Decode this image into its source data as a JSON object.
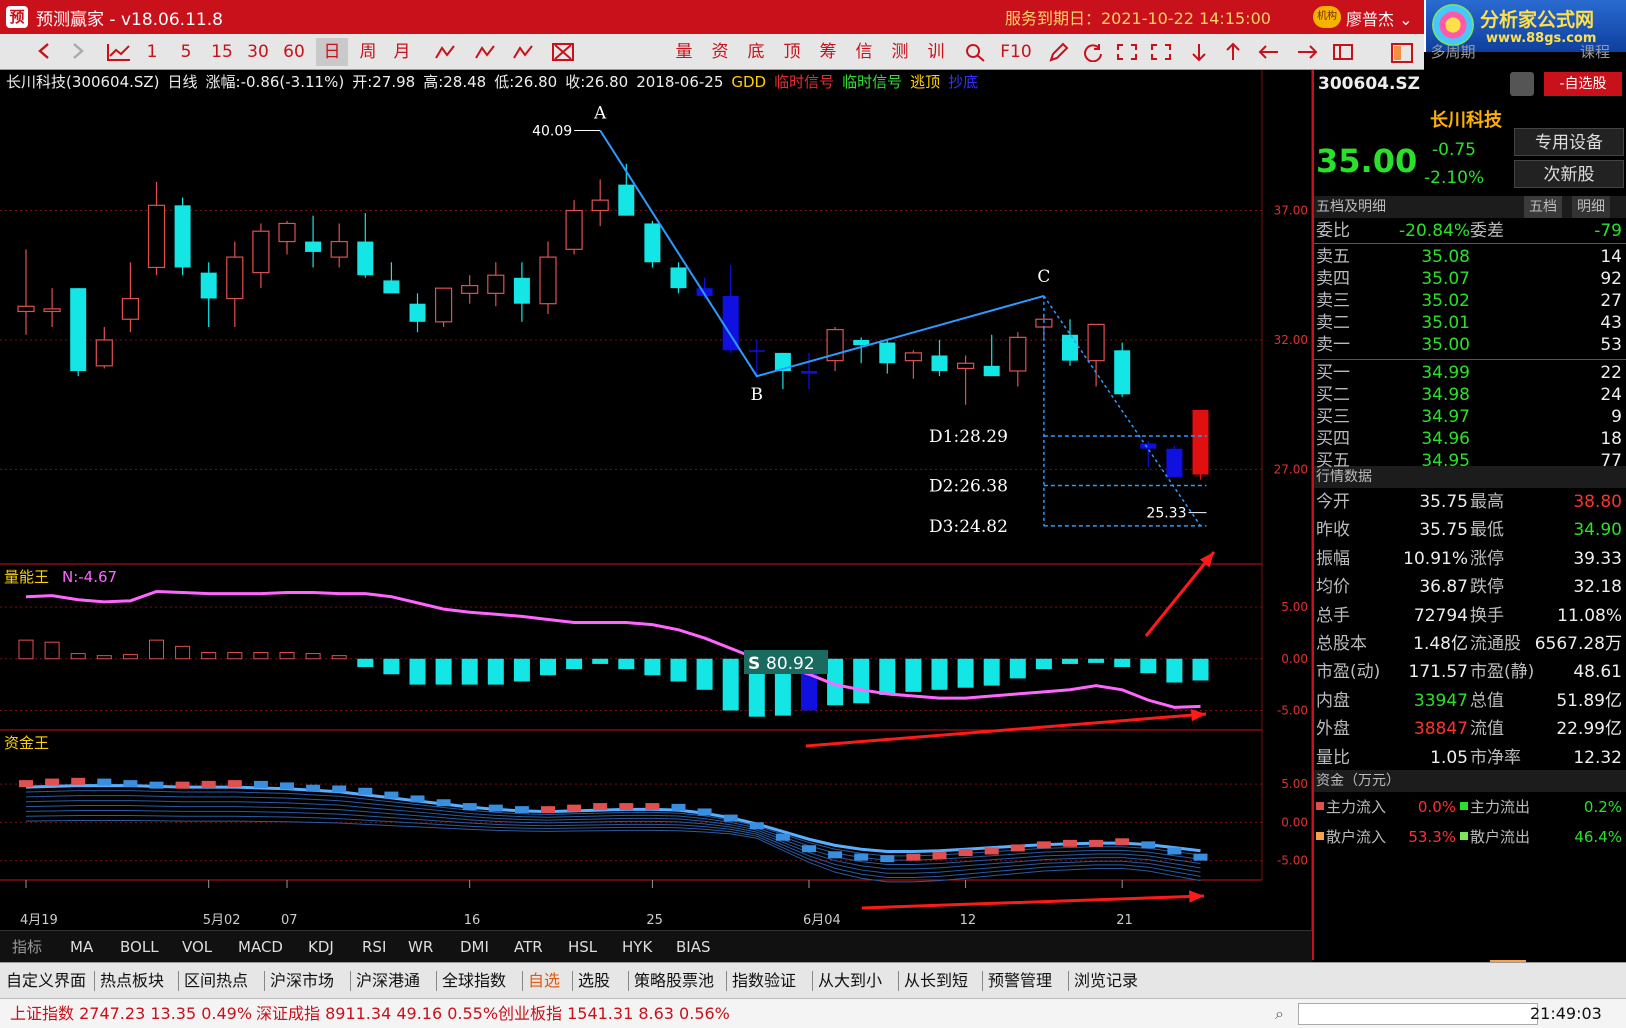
{
  "app": {
    "logo_char": "预",
    "title": "预测赢家 - v18.06.11.8",
    "service": "服务到期日：2021-10-22 14:15:00",
    "badge": "机构",
    "user": "廖普杰",
    "brand_name": "分析家公式网",
    "brand_url": "www.88gs.com"
  },
  "toolbar": {
    "items": [
      "1",
      "5",
      "15",
      "30",
      "60",
      "日",
      "周",
      "月",
      "量",
      "资",
      "底",
      "顶",
      "筹",
      "信",
      "测",
      "训",
      "F10"
    ],
    "active": "日",
    "right_gray": "多周期",
    "right_gray2": "课程"
  },
  "info": {
    "stock": "长川科技(300604.SZ)",
    "period": "日线",
    "change": "涨幅:-0.86(-3.11%)",
    "open": "开:27.98",
    "high": "高:28.48",
    "low": "低:26.80",
    "close": "收:26.80",
    "date": "2018-06-25",
    "s1": "GDD",
    "s2": "临时信号",
    "s3": "临时信号",
    "s4": "逃顶",
    "s5": "抄底"
  },
  "colors": {
    "up": "#e05050",
    "down": "#14e6e6",
    "blue": "#1010e0",
    "red": "#e01010",
    "wave": "#2b9bff",
    "magenta": "#ff66ff",
    "grid": "#7a1010"
  },
  "annotations": {
    "A": "A",
    "B": "B",
    "C": "C",
    "top_value": "40.09",
    "d1": "D1:28.29",
    "d2": "D2:26.38",
    "d3": "D3:24.82",
    "low_value": "25.33"
  },
  "chart_data": [
    {
      "type": "candlestick",
      "title": "",
      "ylim": [
        23.5,
        41.5
      ],
      "yticks": [
        27.0,
        32.0,
        37.0
      ],
      "ytick_labels": [
        "27.00",
        "32.00",
        "37.00"
      ],
      "candles": [
        {
          "o": 33.1,
          "h": 35.5,
          "l": 32.2,
          "c": 33.3
        },
        {
          "o": 33.1,
          "h": 34.0,
          "l": 32.5,
          "c": 33.2
        },
        {
          "o": 34.0,
          "h": 34.0,
          "l": 30.6,
          "c": 30.8
        },
        {
          "o": 31.0,
          "h": 32.5,
          "l": 30.9,
          "c": 32.0
        },
        {
          "o": 32.8,
          "h": 35.0,
          "l": 32.3,
          "c": 33.6
        },
        {
          "o": 34.8,
          "h": 38.1,
          "l": 34.5,
          "c": 37.2
        },
        {
          "o": 37.2,
          "h": 37.5,
          "l": 34.5,
          "c": 34.8
        },
        {
          "o": 34.6,
          "h": 35.0,
          "l": 32.5,
          "c": 33.6
        },
        {
          "o": 33.6,
          "h": 35.8,
          "l": 32.5,
          "c": 35.2
        },
        {
          "o": 34.6,
          "h": 36.5,
          "l": 34.0,
          "c": 36.2
        },
        {
          "o": 35.8,
          "h": 36.6,
          "l": 35.3,
          "c": 36.5
        },
        {
          "o": 35.8,
          "h": 36.8,
          "l": 34.8,
          "c": 35.4
        },
        {
          "o": 35.2,
          "h": 36.5,
          "l": 34.8,
          "c": 35.8
        },
        {
          "o": 35.8,
          "h": 36.9,
          "l": 34.4,
          "c": 34.5
        },
        {
          "o": 34.3,
          "h": 35.0,
          "l": 33.9,
          "c": 33.8
        },
        {
          "o": 33.4,
          "h": 33.8,
          "l": 32.3,
          "c": 32.7
        },
        {
          "o": 32.7,
          "h": 34.0,
          "l": 32.5,
          "c": 34.0
        },
        {
          "o": 33.8,
          "h": 34.5,
          "l": 33.4,
          "c": 34.1
        },
        {
          "o": 33.8,
          "h": 35.0,
          "l": 33.3,
          "c": 34.5
        },
        {
          "o": 34.4,
          "h": 35.0,
          "l": 32.7,
          "c": 33.4
        },
        {
          "o": 33.4,
          "h": 35.8,
          "l": 33.0,
          "c": 35.2
        },
        {
          "o": 35.5,
          "h": 37.4,
          "l": 35.3,
          "c": 37.0
        },
        {
          "o": 37.0,
          "h": 38.2,
          "l": 36.4,
          "c": 37.4
        },
        {
          "o": 38.0,
          "h": 38.8,
          "l": 36.8,
          "c": 36.8
        },
        {
          "o": 36.5,
          "h": 36.6,
          "l": 34.8,
          "c": 35.0
        },
        {
          "o": 34.8,
          "h": 35.0,
          "l": 33.8,
          "c": 34.0
        },
        {
          "o": 34.0,
          "h": 34.4,
          "l": 33.6,
          "c": 33.7
        },
        {
          "o": 33.7,
          "h": 34.9,
          "l": 31.5,
          "c": 31.6
        },
        {
          "o": 31.6,
          "h": 32.0,
          "l": 30.6,
          "c": 31.6
        },
        {
          "o": 31.5,
          "h": 31.5,
          "l": 30.1,
          "c": 30.8
        },
        {
          "o": 30.8,
          "h": 31.5,
          "l": 30.1,
          "c": 30.7
        },
        {
          "o": 31.2,
          "h": 32.5,
          "l": 30.8,
          "c": 32.4
        },
        {
          "o": 32.0,
          "h": 32.1,
          "l": 31.1,
          "c": 31.8
        },
        {
          "o": 31.9,
          "h": 32.0,
          "l": 30.7,
          "c": 31.1
        },
        {
          "o": 31.2,
          "h": 31.6,
          "l": 30.5,
          "c": 31.5
        },
        {
          "o": 31.4,
          "h": 32.0,
          "l": 30.6,
          "c": 30.8
        },
        {
          "o": 30.9,
          "h": 31.4,
          "l": 29.5,
          "c": 31.1
        },
        {
          "o": 31.0,
          "h": 32.2,
          "l": 30.6,
          "c": 30.6
        },
        {
          "o": 30.8,
          "h": 32.3,
          "l": 30.2,
          "c": 32.1
        },
        {
          "o": 32.5,
          "h": 33.0,
          "l": 32.0,
          "c": 32.8
        },
        {
          "o": 32.2,
          "h": 32.8,
          "l": 31.0,
          "c": 31.2
        },
        {
          "o": 31.2,
          "h": 32.6,
          "l": 30.2,
          "c": 32.6
        },
        {
          "o": 31.6,
          "h": 31.9,
          "l": 29.8,
          "c": 29.9
        },
        {
          "o": 28.0,
          "h": 28.1,
          "l": 27.1,
          "c": 27.8
        },
        {
          "o": 27.8,
          "h": 27.9,
          "l": 26.7,
          "c": 26.7
        },
        {
          "o": 26.8,
          "h": 29.3,
          "l": 26.6,
          "c": 29.3
        }
      ],
      "special": {
        "43": "blue",
        "44": "blue",
        "45": "red",
        "26": "blue",
        "27": "blue",
        "28": "blue",
        "30": "blue"
      }
    },
    {
      "type": "bar",
      "title": "量能王",
      "series_label": "N:-4.67",
      "yticks": [
        5.0,
        0.0,
        -5.0
      ],
      "ytick_labels": [
        "5.00",
        "0.00",
        "-5.00"
      ],
      "ylim": [
        -6.5,
        8.0
      ],
      "label_value": "80.92",
      "values": [
        1.8,
        1.6,
        0.5,
        0.3,
        0.4,
        1.8,
        1.2,
        0.6,
        0.6,
        0.6,
        0.6,
        0.5,
        0.3,
        -0.8,
        -1.5,
        -2.5,
        -2.5,
        -2.5,
        -2.5,
        -2.2,
        -1.6,
        -1.0,
        -0.5,
        -1.0,
        -1.6,
        -2.2,
        -3.0,
        -5.0,
        -5.6,
        -5.5,
        -5.0,
        -4.5,
        -4.3,
        -3.5,
        -3.2,
        -3.0,
        -2.8,
        -2.6,
        -1.9,
        -1.0,
        -0.5,
        -0.4,
        -0.8,
        -1.4,
        -2.3,
        -2.1
      ],
      "line": [
        6.0,
        6.1,
        5.7,
        5.5,
        5.6,
        6.5,
        6.4,
        6.3,
        6.3,
        6.3,
        6.4,
        6.4,
        6.3,
        6.3,
        6.0,
        5.4,
        4.8,
        4.5,
        4.3,
        4.1,
        3.8,
        3.5,
        3.5,
        3.5,
        3.3,
        2.8,
        2.0,
        1.0,
        0.0,
        -0.7,
        -1.5,
        -2.5,
        -3.0,
        -3.4,
        -3.6,
        -3.8,
        -3.8,
        -3.6,
        -3.4,
        -3.2,
        -3.0,
        -2.6,
        -3.0,
        -4.0,
        -4.7,
        -4.6
      ]
    },
    {
      "type": "bar",
      "title": "资金王",
      "yticks": [
        5.0,
        0.0,
        -5.0
      ],
      "ytick_labels": [
        "5.00",
        "0.00",
        "-5.00"
      ],
      "ylim": [
        -7.0,
        10.5
      ],
      "values": [
        5.0,
        5.2,
        5.3,
        5.2,
        5.0,
        4.8,
        4.8,
        4.9,
        5.0,
        4.9,
        4.7,
        4.4,
        4.3,
        4.0,
        3.5,
        3.0,
        2.5,
        2.0,
        1.8,
        1.6,
        1.6,
        1.8,
        2.0,
        2.0,
        2.0,
        1.9,
        1.3,
        0.5,
        -0.5,
        -2.0,
        -3.5,
        -4.3,
        -4.6,
        -4.8,
        -4.6,
        -4.4,
        -4.0,
        -3.8,
        -3.4,
        -3.0,
        -2.8,
        -2.8,
        -2.6,
        -3.0,
        -3.8,
        -4.6
      ],
      "line": [
        4.6,
        4.7,
        4.8,
        4.8,
        4.8,
        4.7,
        4.6,
        4.6,
        4.6,
        4.5,
        4.4,
        4.2,
        4.0,
        3.6,
        3.2,
        2.8,
        2.4,
        2.0,
        1.7,
        1.5,
        1.4,
        1.5,
        1.6,
        1.7,
        1.7,
        1.6,
        1.2,
        0.6,
        -0.2,
        -1.2,
        -2.2,
        -3.0,
        -3.5,
        -3.8,
        -3.8,
        -3.7,
        -3.5,
        -3.3,
        -3.1,
        -2.9,
        -2.8,
        -2.7,
        -2.7,
        -2.9,
        -3.3,
        -3.7
      ]
    }
  ],
  "xaxis": {
    "labels": [
      "4月19",
      "5月02",
      "07",
      "16",
      "25",
      "6月04",
      "12",
      "21"
    ],
    "label_idx": [
      0,
      7,
      10,
      17,
      24,
      30,
      36,
      42
    ]
  },
  "right": {
    "code": "300604.SZ",
    "self": "-自选股",
    "name": "长川科技",
    "price": "35.00",
    "chg": "-0.75",
    "pct": "-2.10%",
    "btn1": "专用设备",
    "btn2": "次新股",
    "sec_book": "五档及明细",
    "tab1": "五档",
    "tab2": "明细",
    "weibi_label": "委比",
    "weibi": "-20.84%",
    "weicha_label": "委差",
    "weicha": "-79",
    "asks": [
      {
        "l": "卖五",
        "p": "35.08",
        "q": "14"
      },
      {
        "l": "卖四",
        "p": "35.07",
        "q": "92"
      },
      {
        "l": "卖三",
        "p": "35.02",
        "q": "27"
      },
      {
        "l": "卖二",
        "p": "35.01",
        "q": "43"
      },
      {
        "l": "卖一",
        "p": "35.00",
        "q": "53"
      }
    ],
    "bids": [
      {
        "l": "买一",
        "p": "34.99",
        "q": "22"
      },
      {
        "l": "买二",
        "p": "34.98",
        "q": "24"
      },
      {
        "l": "买三",
        "p": "34.97",
        "q": "9"
      },
      {
        "l": "买四",
        "p": "34.96",
        "q": "18"
      },
      {
        "l": "买五",
        "p": "34.95",
        "q": "77"
      }
    ],
    "sec_quote": "行情数据",
    "quote": [
      {
        "l1": "今开",
        "v1": "35.75",
        "l2": "最高",
        "v2": "38.80",
        "c2": "#ff3030"
      },
      {
        "l1": "昨收",
        "v1": "35.75",
        "l2": "最低",
        "v2": "34.90",
        "c2": "#2ae02a"
      },
      {
        "l1": "振幅",
        "v1": "10.91%",
        "l2": "涨停",
        "v2": "39.33"
      },
      {
        "l1": "均价",
        "v1": "36.87",
        "l2": "跌停",
        "v2": "32.18"
      },
      {
        "l1": "总手",
        "v1": "72794",
        "l2": "换手",
        "v2": "11.08%"
      },
      {
        "l1": "总股本",
        "v1": "1.48亿",
        "l2": "流通股",
        "v2": "6567.28万"
      },
      {
        "l1": "市盈(动)",
        "v1": "171.57",
        "l2": "市盈(静)",
        "v2": "48.61"
      },
      {
        "l1": "内盘",
        "v1": "33947",
        "c1": "#2ae02a",
        "l2": "总值",
        "v2": "51.89亿"
      },
      {
        "l1": "外盘",
        "v1": "38847",
        "c1": "#ff3030",
        "l2": "流值",
        "v2": "22.99亿"
      },
      {
        "l1": "量比",
        "v1": "1.05",
        "l2": "市净率",
        "v2": "12.32"
      }
    ],
    "sec_fund": "资金（万元）",
    "fund": [
      {
        "l1": "主力流入",
        "v1": "0.0%",
        "l2": "主力流出",
        "v2": "0.2%"
      },
      {
        "l1": "散户流入",
        "v1": "53.3%",
        "l2": "散户流出",
        "v2": "46.4%"
      }
    ]
  },
  "indicators": {
    "label": "指标",
    "items": [
      "MA",
      "BOLL",
      "VOL",
      "MACD",
      "KDJ",
      "RSI",
      "WR",
      "DMI",
      "ATR",
      "HSL",
      "HYK",
      "BIAS"
    ]
  },
  "nav": [
    "自定义界面",
    "热点板块",
    "区间热点",
    "沪深市场",
    "沪深港通",
    "全球指数",
    "自选",
    "选股",
    "策略股票池",
    "指数验证",
    "从大到小",
    "从长到短",
    "预警管理",
    "浏览记录"
  ],
  "nav_active": "自选",
  "status": {
    "sh": "上证指数 2747.23 13.35 0.49%",
    "sz": "深证成指 8911.34 49.16 0.55%",
    "cy": "创业板指 1541.31 8.63 0.56%",
    "time": "21:49:03"
  }
}
